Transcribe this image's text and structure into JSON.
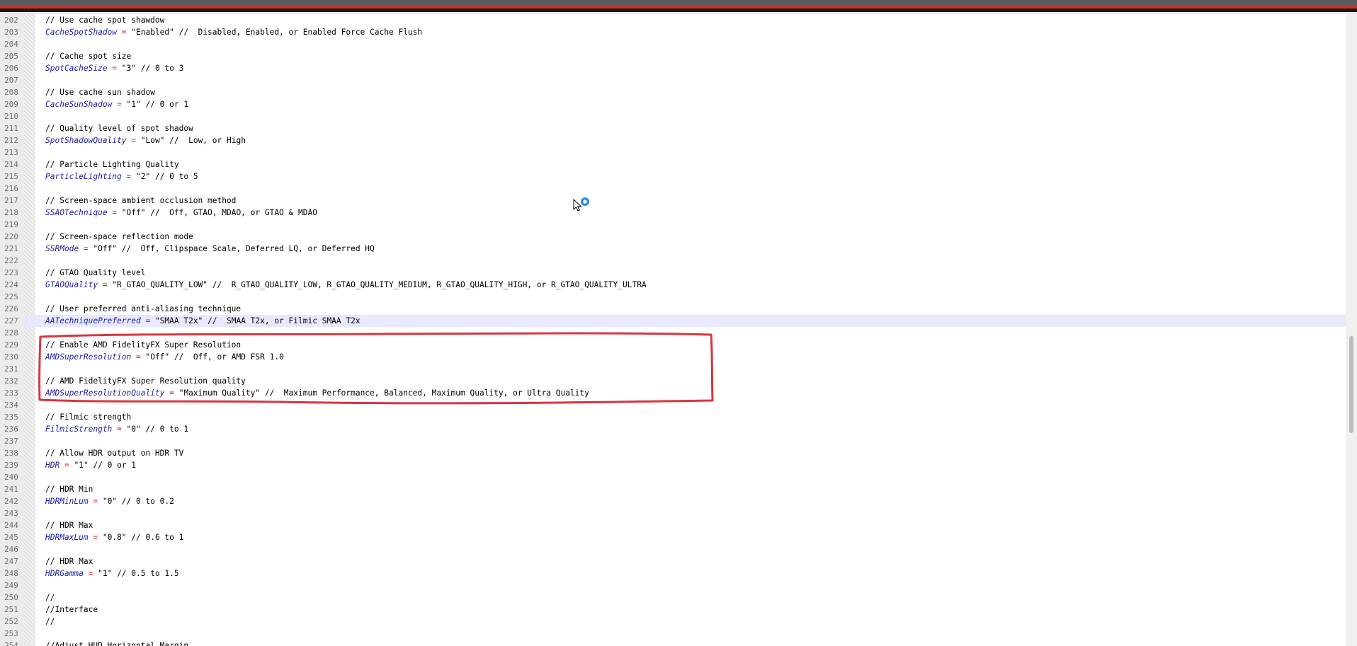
{
  "editor": {
    "lines": [
      {
        "n": "202",
        "comment": "// Use cache spot shawdow"
      },
      {
        "n": "203",
        "key": "CacheSpotShadow",
        "value": "\"Enabled\"",
        "note": " //  Disabled, Enabled, or Enabled Force Cache Flush"
      },
      {
        "n": "204"
      },
      {
        "n": "205",
        "comment": "// Cache spot size"
      },
      {
        "n": "206",
        "key": "SpotCacheSize",
        "value": "\"3\"",
        "note": " // 0 to 3"
      },
      {
        "n": "207"
      },
      {
        "n": "208",
        "comment": "// Use cache sun shadow"
      },
      {
        "n": "209",
        "key": "CacheSunShadow",
        "value": "\"1\"",
        "note": " // 0 or 1"
      },
      {
        "n": "210"
      },
      {
        "n": "211",
        "comment": "// Quality level of spot shadow"
      },
      {
        "n": "212",
        "key": "SpotShadowQuality",
        "value": "\"Low\"",
        "note": " //  Low, or High"
      },
      {
        "n": "213"
      },
      {
        "n": "214",
        "comment": "// Particle Lighting Quality"
      },
      {
        "n": "215",
        "key": "ParticleLighting",
        "value": "\"2\"",
        "note": " // 0 to 5"
      },
      {
        "n": "216"
      },
      {
        "n": "217",
        "comment": "// Screen-space ambient occlusion method"
      },
      {
        "n": "218",
        "key": "SSAOTechnique",
        "value": "\"Off\"",
        "note": " //  Off, GTAO, MDAO, or GTAO & MDAO"
      },
      {
        "n": "219"
      },
      {
        "n": "220",
        "comment": "// Screen-space reflection mode"
      },
      {
        "n": "221",
        "key": "SSRMode",
        "value": "\"Off\"",
        "note": " //  Off, Clipspace Scale, Deferred LQ, or Deferred HQ"
      },
      {
        "n": "222"
      },
      {
        "n": "223",
        "comment": "// GTAO Quality level"
      },
      {
        "n": "224",
        "key": "GTAOQuality",
        "value": "\"R_GTAO_QUALITY_LOW\"",
        "note": " //  R_GTAO_QUALITY_LOW, R_GTAO_QUALITY_MEDIUM, R_GTAO_QUALITY_HIGH, or R_GTAO_QUALITY_ULTRA"
      },
      {
        "n": "225"
      },
      {
        "n": "226",
        "comment": "// User preferred anti-aliasing technique"
      },
      {
        "n": "227",
        "key": "AATechniquePreferred",
        "value": "\"SMAA T2x\"",
        "note": " //  SMAA T2x, or Filmic SMAA T2x",
        "current": true
      },
      {
        "n": "228"
      },
      {
        "n": "229",
        "comment": "// Enable AMD FidelityFX Super Resolution"
      },
      {
        "n": "230",
        "key": "AMDSuperResolution",
        "value": "\"Off\"",
        "note": " //  Off, or AMD FSR 1.0"
      },
      {
        "n": "231"
      },
      {
        "n": "232",
        "comment": "// AMD FidelityFX Super Resolution quality"
      },
      {
        "n": "233",
        "key": "AMDSuperResolutionQuality",
        "value": "\"Maximum Quality\"",
        "note": " //  Maximum Performance, Balanced, Maximum Quality, or Ultra Quality"
      },
      {
        "n": "234"
      },
      {
        "n": "235",
        "comment": "// Filmic strength"
      },
      {
        "n": "236",
        "key": "FilmicStrength",
        "value": "\"0\"",
        "note": " // 0 to 1"
      },
      {
        "n": "237"
      },
      {
        "n": "238",
        "comment": "// Allow HDR output on HDR TV"
      },
      {
        "n": "239",
        "key": "HDR",
        "value": "\"1\"",
        "note": " // 0 or 1"
      },
      {
        "n": "240"
      },
      {
        "n": "241",
        "comment": "// HDR Min"
      },
      {
        "n": "242",
        "key": "HDRMinLum",
        "value": "\"0\"",
        "note": " // 0 to 0.2"
      },
      {
        "n": "243"
      },
      {
        "n": "244",
        "comment": "// HDR Max"
      },
      {
        "n": "245",
        "key": "HDRMaxLum",
        "value": "\"0.8\"",
        "note": " // 0.6 to 1"
      },
      {
        "n": "246"
      },
      {
        "n": "247",
        "comment": "// HDR Max"
      },
      {
        "n": "248",
        "key": "HDRGamma",
        "value": "\"1\"",
        "note": " // 0.5 to 1.5"
      },
      {
        "n": "249"
      },
      {
        "n": "250",
        "comment": "//"
      },
      {
        "n": "251",
        "comment": "//Interface"
      },
      {
        "n": "252",
        "comment": "//"
      },
      {
        "n": "253"
      },
      {
        "n": "254",
        "comment": "//Adjust HUD Horizontal Margin"
      }
    ]
  },
  "colors": {
    "key": "#1e23a6",
    "operator": "#e81010",
    "annotation": "#d9343f",
    "current_line": "#e8e8ff",
    "cursor_badge": "#2a8fe0"
  },
  "icons": {
    "cursor": "arrow-cursor-with-loading-icon"
  }
}
